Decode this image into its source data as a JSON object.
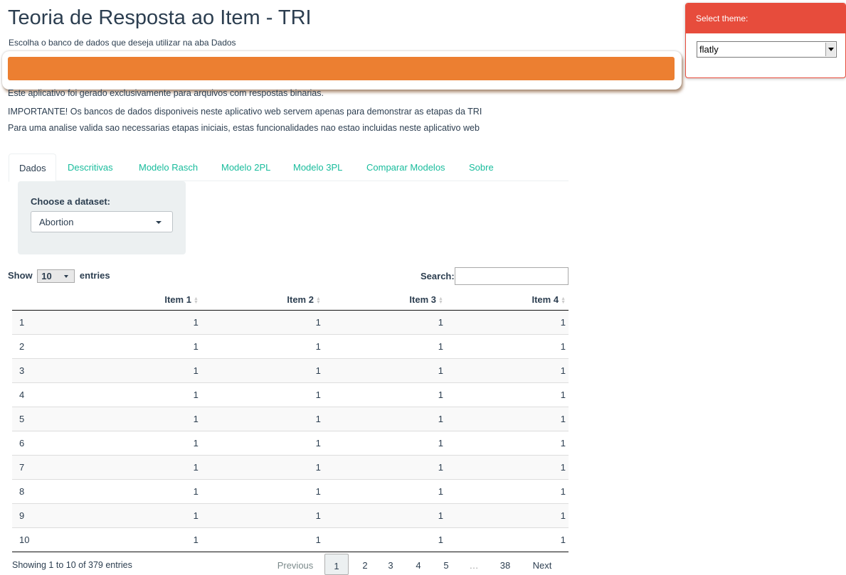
{
  "header": {
    "title": "Teoria de Resposta ao Item - TRI",
    "subtitle": "Escolha o banco de dados que deseja utilizar na aba Dados"
  },
  "colors": {
    "accent": "#ec7f31",
    "theme_panel": "#e74c3c",
    "link": "#18bc9c",
    "text": "#2c3e50"
  },
  "info_lines": [
    "Este aplicativo foi gerado exclusivamente para arquivos com respostas binarias.",
    "IMPORTANTE! Os bancos de dados disponiveis neste aplicativo web servem apenas para demonstrar as etapas da TRI",
    "Para uma analise valida sao necessarias etapas iniciais, estas funcionalidades nao estao incluidas neste aplicativo web"
  ],
  "theme_panel": {
    "label": "Select theme:",
    "value": "flatly"
  },
  "tabs": [
    "Dados",
    "Descritivas",
    "Modelo Rasch",
    "Modelo 2PL",
    "Modelo 3PL",
    "Comparar Modelos",
    "Sobre"
  ],
  "dataset": {
    "label": "Choose a dataset:",
    "value": "Abortion"
  },
  "table_controls": {
    "show": "Show",
    "length": "10",
    "entries": "entries",
    "search_label": "Search:"
  },
  "table": {
    "columns": [
      "",
      "Item 1",
      "Item 2",
      "Item 3",
      "Item 4"
    ],
    "rows": [
      [
        "1",
        "1",
        "1",
        "1",
        "1"
      ],
      [
        "2",
        "1",
        "1",
        "1",
        "1"
      ],
      [
        "3",
        "1",
        "1",
        "1",
        "1"
      ],
      [
        "4",
        "1",
        "1",
        "1",
        "1"
      ],
      [
        "5",
        "1",
        "1",
        "1",
        "1"
      ],
      [
        "6",
        "1",
        "1",
        "1",
        "1"
      ],
      [
        "7",
        "1",
        "1",
        "1",
        "1"
      ],
      [
        "8",
        "1",
        "1",
        "1",
        "1"
      ],
      [
        "9",
        "1",
        "1",
        "1",
        "1"
      ],
      [
        "10",
        "1",
        "1",
        "1",
        "1"
      ]
    ]
  },
  "table_info": "Showing 1 to 10 of 379 entries",
  "pagination": {
    "previous": "Previous",
    "pages": [
      "1",
      "2",
      "3",
      "4",
      "5",
      "…",
      "38"
    ],
    "next": "Next"
  }
}
